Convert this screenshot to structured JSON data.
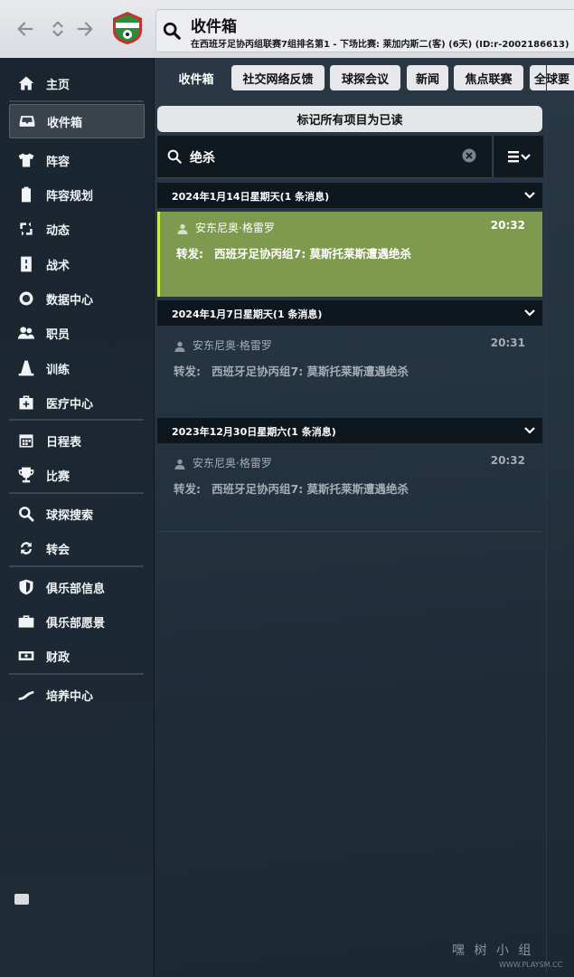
{
  "header": {
    "title": "收件箱",
    "subtitle": "在西班牙足协丙组联赛7组排名第1 - 下场比赛: 莱加内斯二(客) (6天) (ID:r-2002186613)"
  },
  "sidebar": {
    "items": [
      {
        "label": "主页",
        "icon": "home-icon"
      },
      {
        "label": "收件箱",
        "icon": "inbox-icon",
        "active": true
      },
      {
        "label": "阵容",
        "icon": "shirt-icon"
      },
      {
        "label": "阵容规划",
        "icon": "clipboard-icon"
      },
      {
        "label": "动态",
        "icon": "dynamics-icon"
      },
      {
        "label": "战术",
        "icon": "tactics-icon"
      },
      {
        "label": "数据中心",
        "icon": "data-hub-icon"
      },
      {
        "label": "职员",
        "icon": "staff-icon"
      },
      {
        "label": "训练",
        "icon": "training-cone-icon"
      },
      {
        "label": "医疗中心",
        "icon": "medical-icon"
      },
      {
        "label": "日程表",
        "icon": "calendar-icon"
      },
      {
        "label": "比赛",
        "icon": "trophy-icon"
      },
      {
        "label": "球探搜索",
        "icon": "search-icon"
      },
      {
        "label": "转会",
        "icon": "transfer-icon"
      },
      {
        "label": "俱乐部信息",
        "icon": "shield-icon"
      },
      {
        "label": "俱乐部愿景",
        "icon": "briefcase-icon"
      },
      {
        "label": "财政",
        "icon": "money-icon"
      },
      {
        "label": "培养中心",
        "icon": "development-icon"
      }
    ]
  },
  "tabs": [
    "收件箱",
    "社交网络反馈",
    "球探会议",
    "新闻",
    "焦点联赛",
    "全球要"
  ],
  "actions": {
    "mark_all_read": "标记所有项目为已读"
  },
  "search": {
    "value": "绝杀"
  },
  "messages": {
    "groups": [
      {
        "date": "2024年1月14日星期天(1 条消息)",
        "items": [
          {
            "sender": "安东尼奥·格雷罗",
            "time": "20:32",
            "prefix": "转发:",
            "subject": "西班牙足协丙组7: 莫斯托莱斯遭遇绝杀",
            "selected": true
          }
        ]
      },
      {
        "date": "2024年1月7日星期天(1 条消息)",
        "items": [
          {
            "sender": "安东尼奥·格雷罗",
            "time": "20:31",
            "prefix": "转发:",
            "subject": "西班牙足协丙组7: 莫斯托莱斯遭遇绝杀",
            "selected": false
          }
        ]
      },
      {
        "date": "2023年12月30日星期六(1 条消息)",
        "items": [
          {
            "sender": "安东尼奥·格雷罗",
            "time": "20:32",
            "prefix": "转发:",
            "subject": "西班牙足协丙组7: 莫斯托莱斯遭遇绝杀",
            "selected": false
          }
        ]
      }
    ]
  },
  "watermark": {
    "text": "嘿 树 小 组",
    "sub": "WWW.PLAYSM.CC"
  },
  "colors": {
    "selected_bg": "#7d9a4e",
    "selected_accent": "#c9f04b",
    "sidebar_bg": "#1a2530"
  }
}
